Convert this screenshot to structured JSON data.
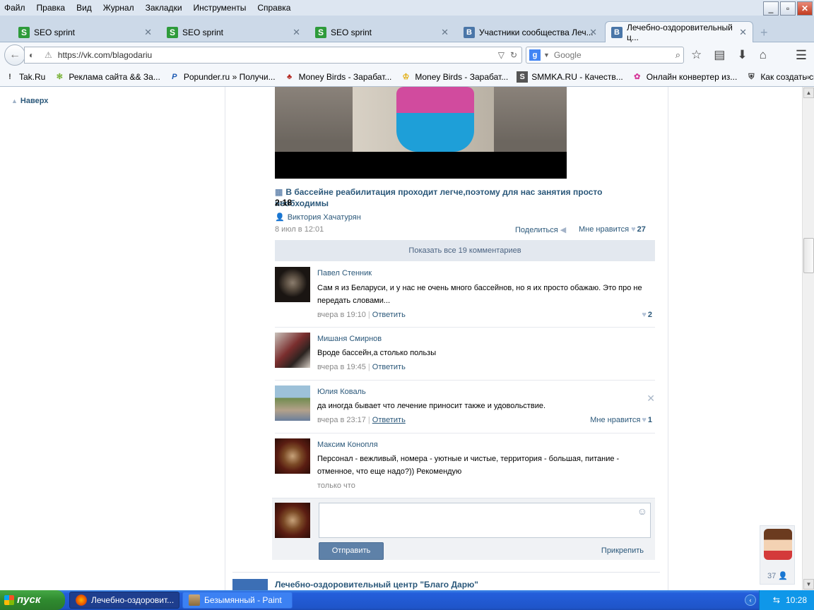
{
  "menu": [
    "Файл",
    "Правка",
    "Вид",
    "Журнал",
    "Закладки",
    "Инструменты",
    "Справка"
  ],
  "window_controls": [
    "_",
    "▫",
    "✕"
  ],
  "tabs": [
    {
      "label": "SEO sprint",
      "icon": "S"
    },
    {
      "label": "SEO sprint",
      "icon": "S"
    },
    {
      "label": "SEO sprint",
      "icon": "S"
    },
    {
      "label": "Участники сообщества Леч...",
      "icon": "B"
    },
    {
      "label": "Лечебно-оздоровительный ц...",
      "icon": "B"
    }
  ],
  "newtab_label": "+",
  "address": {
    "url": "https://vk.com/blagodariu"
  },
  "search": {
    "placeholder": "Google",
    "engine_icon": "g"
  },
  "bookmarks": [
    {
      "label": "Tak.Ru"
    },
    {
      "label": "Реклама сайта && За..."
    },
    {
      "label": "Popunder.ru » Получи..."
    },
    {
      "label": "Money Birds - Зарабат..."
    },
    {
      "label": "Money Birds - Зарабат..."
    },
    {
      "label": "SMMKA.RU - Качеств..."
    },
    {
      "label": "Онлайн конвертер из..."
    },
    {
      "label": "Как создать свой чит..."
    }
  ],
  "bookmarks_more": "»",
  "sidebar": {
    "up_label": "Наверх"
  },
  "video": {
    "title": "В бассейне реабилитация проходит легче,поэтому для нас занятия просто необходимы",
    "duration": "2:18",
    "author": "Виктория Хачатурян",
    "date": "8 июл в 12:01",
    "share_label": "Поделиться",
    "like_label": "Мне нравится",
    "like_count": "27"
  },
  "show_all_label": "Показать все 19 комментариев",
  "comments": [
    {
      "name": "Павел Стенник",
      "text": "Сам я из Беларуси, и у нас не очень много бассейнов, но я их просто обажаю. Это про не передать словами...",
      "time": "вчера в 19:10",
      "reply": "Ответить",
      "like_label": "",
      "likes": "2"
    },
    {
      "name": "Мишаня Смирнов",
      "text": "Вроде бассейн,а столько пользы",
      "time": "вчера в 19:45",
      "reply": "Ответить",
      "like_label": "",
      "likes": ""
    },
    {
      "name": "Юлия Коваль",
      "text": "да иногда бывает что лечение приносит также и удовольствие.",
      "time": "вчера в 23:17",
      "reply": "Ответить",
      "like_label": "Мне нравится",
      "likes": "1"
    },
    {
      "name": "Максим Конопля",
      "text": "Персонал - вежливый, номера - уютные и чистые, территория - большая, питание - отменное, что еще надо?)) Рекомендую",
      "time": "только что",
      "reply": "",
      "like_label": "",
      "likes": ""
    }
  ],
  "reply_box": {
    "send_label": "Отправить",
    "attach_label": "Прикрепить"
  },
  "group": {
    "name": "Лечебно-оздоровительный центр \"Благо Дарю\""
  },
  "chat_widget": {
    "count": "37"
  },
  "taskbar": {
    "start_label": "пуск",
    "items": [
      {
        "label": "Лечебно-оздоровит..."
      },
      {
        "label": "Безымянный - Paint"
      }
    ],
    "clock": "10:28"
  },
  "colors": {
    "link": "#2b587a",
    "vk_blue": "#5e81a8",
    "taskbar": "#245edb"
  }
}
